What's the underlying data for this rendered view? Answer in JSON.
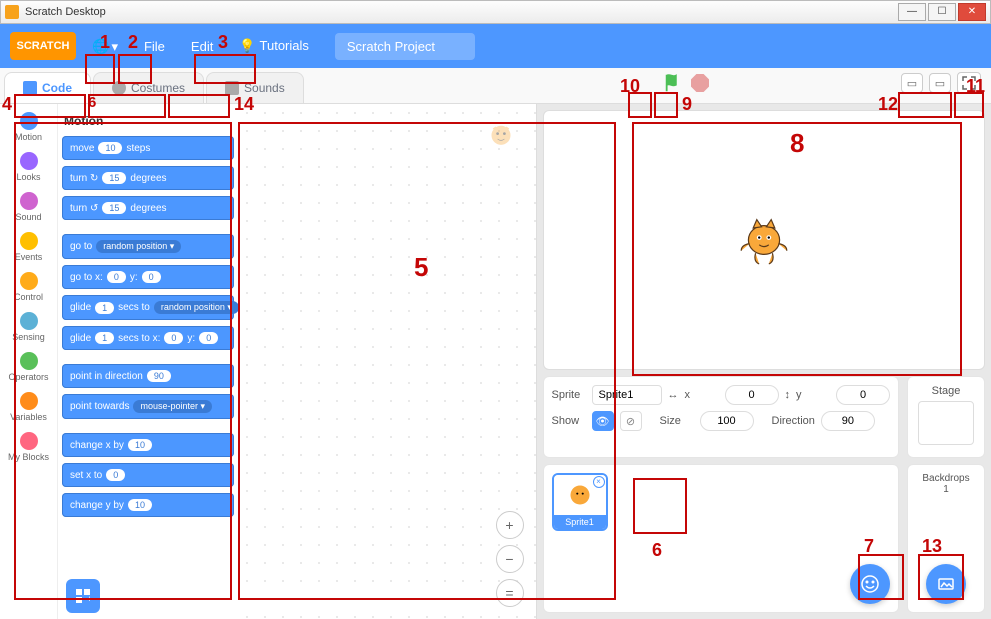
{
  "window": {
    "title": "Scratch Desktop"
  },
  "menubar": {
    "logo_text": "SCRATCH",
    "file": "File",
    "edit": "Edit",
    "tutorials": "Tutorials",
    "project_title": "Scratch Project"
  },
  "tabs": {
    "code": "Code",
    "costumes": "Costumes",
    "sounds": "Sounds"
  },
  "categories": [
    {
      "name": "Motion",
      "color": "#4c97ff"
    },
    {
      "name": "Looks",
      "color": "#9966ff"
    },
    {
      "name": "Sound",
      "color": "#cf63cf"
    },
    {
      "name": "Events",
      "color": "#ffbf00"
    },
    {
      "name": "Control",
      "color": "#ffab19"
    },
    {
      "name": "Sensing",
      "color": "#5cb1d6"
    },
    {
      "name": "Operators",
      "color": "#59c059"
    },
    {
      "name": "Variables",
      "color": "#ff8c1a"
    },
    {
      "name": "My Blocks",
      "color": "#ff6680"
    }
  ],
  "blocks_header": "Motion",
  "blocks": {
    "move": {
      "pre": "move",
      "val": "10",
      "post": "steps"
    },
    "turncw": {
      "pre": "turn ↻",
      "val": "15",
      "post": "degrees"
    },
    "turnccw": {
      "pre": "turn ↺",
      "val": "15",
      "post": "degrees"
    },
    "goto": {
      "pre": "go to",
      "drop": "random position ▾"
    },
    "gotoxy": {
      "pre": "go to x:",
      "v1": "0",
      "mid": "y:",
      "v2": "0"
    },
    "glide1": {
      "pre": "glide",
      "v1": "1",
      "mid": "secs to",
      "drop": "random position ▾"
    },
    "glide2": {
      "pre": "glide",
      "v1": "1",
      "mid": "secs to x:",
      "v2": "0",
      "mid2": "y:",
      "v3": "0"
    },
    "pointdir": {
      "pre": "point in direction",
      "val": "90"
    },
    "pointtw": {
      "pre": "point towards",
      "drop": "mouse-pointer ▾"
    },
    "changex": {
      "pre": "change x by",
      "val": "10"
    },
    "setx": {
      "pre": "set x to",
      "val": "0"
    },
    "changey": {
      "pre": "change y by",
      "val": "10"
    }
  },
  "sprite_info": {
    "label_sprite": "Sprite",
    "name": "Sprite1",
    "label_x": "x",
    "x": "0",
    "label_y": "y",
    "y": "0",
    "label_show": "Show",
    "label_size": "Size",
    "size": "100",
    "label_direction": "Direction",
    "direction": "90"
  },
  "stage_panel": {
    "title": "Stage",
    "backdrops_label": "Backdrops",
    "backdrops_count": "1"
  },
  "sprite_tile": {
    "name": "Sprite1"
  },
  "annotations": {
    "n1": "1",
    "n2": "2",
    "n3": "3",
    "n4": "4",
    "n5": "5",
    "n6": "6",
    "n7": "7",
    "n8": "8",
    "n9": "9",
    "n10": "10",
    "n11": "11",
    "n12": "12",
    "n13": "13",
    "n14": "14",
    "n6b": "6"
  }
}
